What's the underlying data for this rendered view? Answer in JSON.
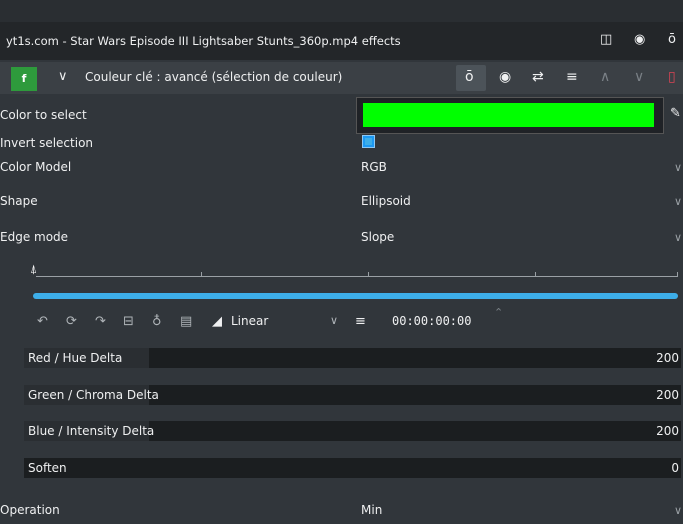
{
  "header": {
    "title": "yt1s.com - Star Wars Episode III Lightsaber Stunts_360p.mp4 effects",
    "icons": [
      "split-view-icon",
      "eye-icon",
      "timer-icon"
    ]
  },
  "effect": {
    "badge": "f",
    "name": "Couleur clé : avancé (sélection de couleur)",
    "icons": [
      "timer-icon",
      "eye-icon",
      "compare-icon",
      "menu-icon",
      "chevron-up-icon",
      "chevron-down-icon",
      "delete-icon"
    ],
    "accent": "#2e9a3c"
  },
  "params": {
    "color_to_select": {
      "label": "Color to select",
      "color": "#00ff00"
    },
    "invert_selection": {
      "label": "Invert selection",
      "checked": true
    },
    "color_model": {
      "label": "Color Model",
      "value": "RGB"
    },
    "shape": {
      "label": "Shape",
      "value": "Ellipsoid"
    },
    "edge_mode": {
      "label": "Edge mode",
      "value": "Slope"
    },
    "operation": {
      "label": "Operation",
      "value": "Min"
    }
  },
  "keyframes": {
    "interpolation": "Linear",
    "timecode": "00:00:00:00",
    "accent": "#3daee9"
  },
  "sliders": [
    {
      "label": "Red / Hue Delta",
      "value": "200",
      "fill": 0.19
    },
    {
      "label": "Green / Chroma Delta",
      "value": "200",
      "fill": 0.19
    },
    {
      "label": "Blue / Intensity Delta",
      "value": "200",
      "fill": 0.19
    },
    {
      "label": "Soften",
      "value": "0",
      "fill": 0.0
    }
  ]
}
